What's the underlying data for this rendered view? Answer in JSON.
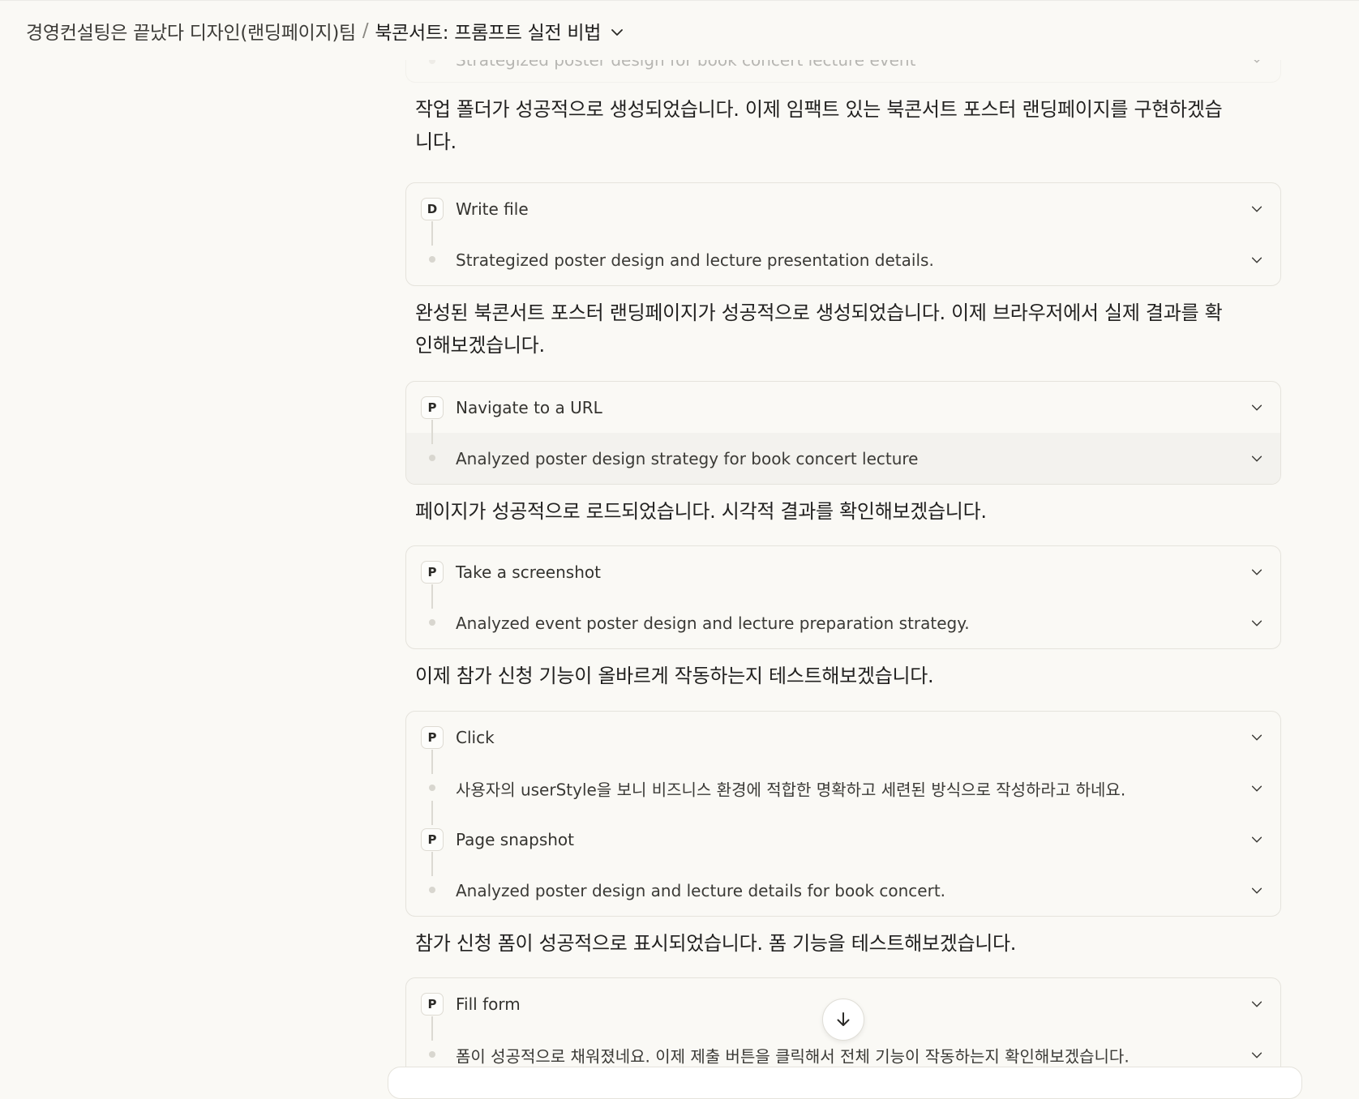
{
  "header": {
    "project": "경영컨설팅은 끝났다 디자인(랜딩페이지)팀",
    "separator": "/",
    "title": "북콘서트: 프롬프트 실전 비법"
  },
  "cards": [
    {
      "rows": [
        {
          "label": "Strategized poster design for book concert lecture event"
        }
      ]
    },
    {
      "rows": [
        {
          "badge": "D",
          "label": "Write file"
        },
        {
          "label": "Strategized poster design and lecture presentation details."
        }
      ]
    },
    {
      "rows": [
        {
          "badge": "P",
          "label": "Navigate to a URL"
        },
        {
          "label": "Analyzed poster design strategy for book concert lecture"
        }
      ]
    },
    {
      "rows": [
        {
          "badge": "P",
          "label": "Take a screenshot"
        },
        {
          "label": "Analyzed event poster design and lecture preparation strategy."
        }
      ]
    },
    {
      "rows": [
        {
          "badge": "P",
          "label": "Click"
        },
        {
          "label": "사용자의 userStyle을 보니 비즈니스 환경에 적합한 명확하고 세련된 방식으로 작성하라고 하네요."
        },
        {
          "badge": "P",
          "label": "Page snapshot"
        },
        {
          "label": "Analyzed poster design and lecture details for book concert."
        }
      ]
    },
    {
      "rows": [
        {
          "badge": "P",
          "label": "Fill form"
        },
        {
          "label": "폼이 성공적으로 채워졌네요. 이제 제출 버튼을 클릭해서 전체 기능이 작동하는지 확인해보겠습니다."
        }
      ]
    }
  ],
  "messages": [
    {
      "line1": "작업 폴더가 성공적으로 생성되었습니다. 이제 임팩트 있는 북콘서트 포스터 랜딩페이지를 구현하겠습",
      "line2": "니다."
    },
    {
      "line1": "완성된 북콘서트 포스터 랜딩페이지가 성공적으로 생성되었습니다. 이제 브라우저에서 실제 결과를 확",
      "line2": "인해보겠습니다."
    },
    {
      "line1": "페이지가 성공적으로 로드되었습니다. 시각적 결과를 확인해보겠습니다."
    },
    {
      "line1": "이제 참가 신청 기능이 올바르게 작동하는지 테스트해보겠습니다."
    },
    {
      "line1": "참가 신청 폼이 성공적으로 표시되었습니다. 폼 기능을 테스트해보겠습니다."
    }
  ],
  "icons": {
    "title_chevron": "chevron-down-icon",
    "row_chevron": "chevron-down-icon",
    "scroll": "arrow-down-icon"
  }
}
